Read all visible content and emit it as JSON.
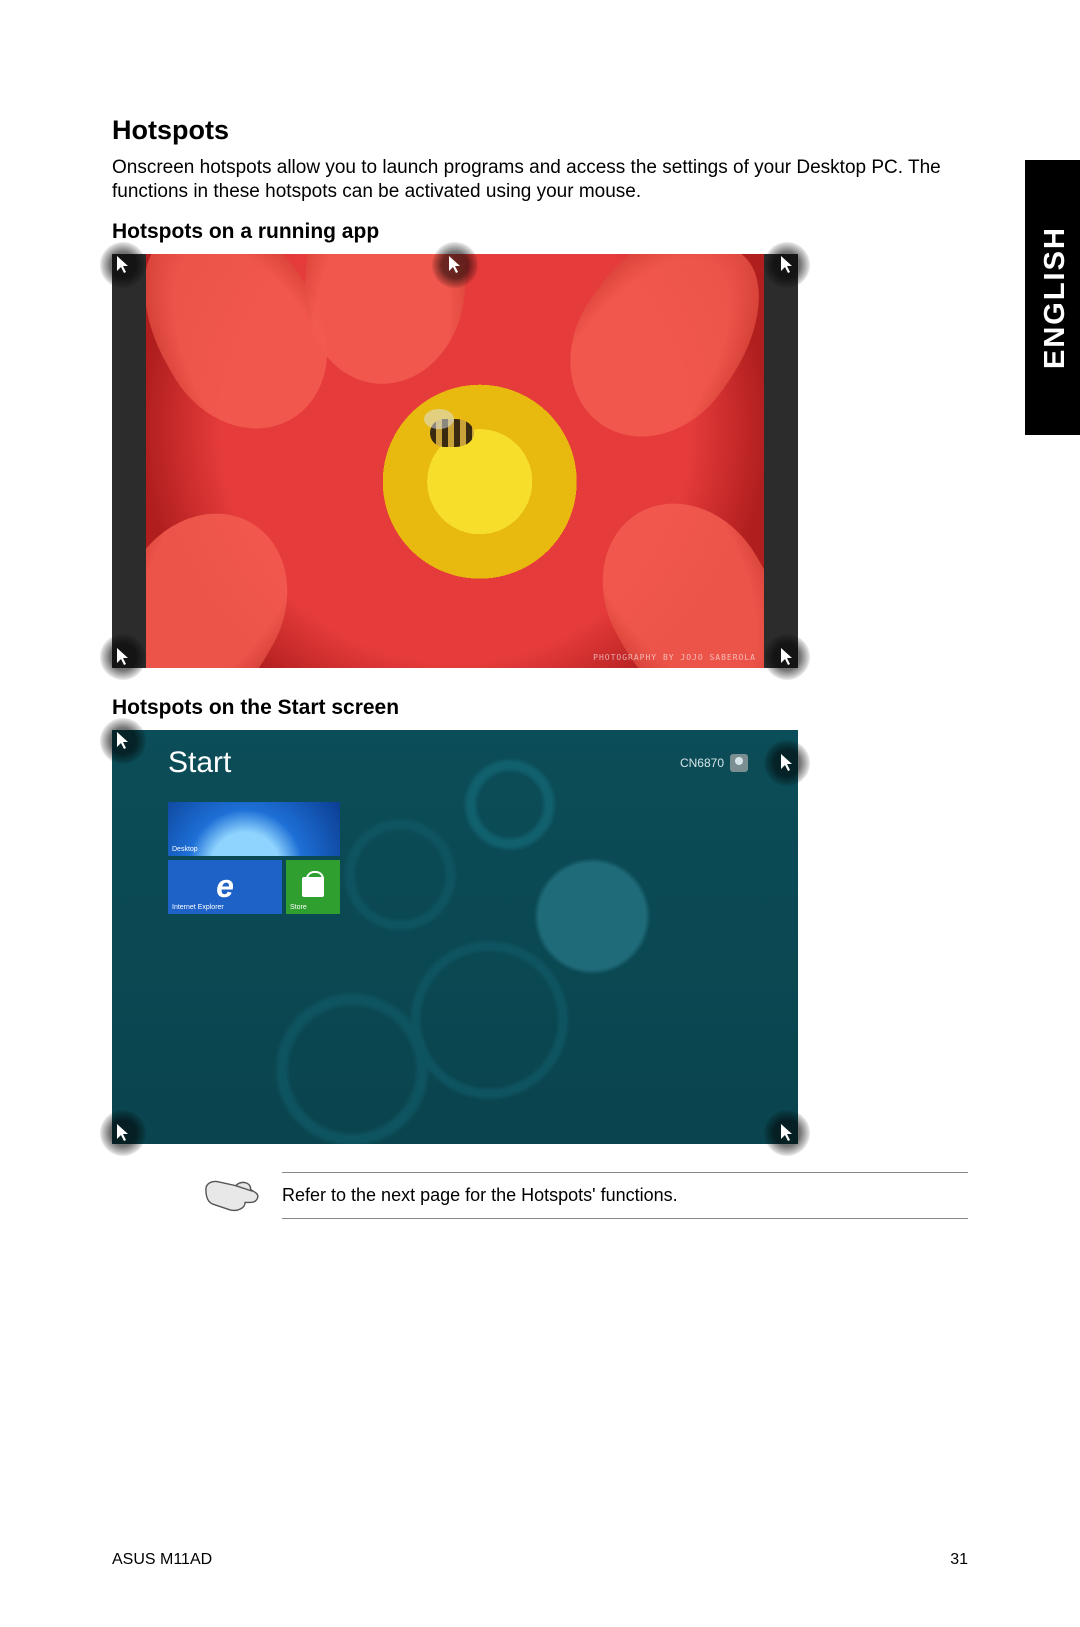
{
  "language_tab": "ENGLISH",
  "heading": "Hotspots",
  "intro": "Onscreen hotspots allow you to launch programs and access the settings of your Desktop PC. The functions in these hotspots can be activated using your mouse.",
  "sub1": "Hotspots on a running app",
  "sub2": "Hotspots on the Start screen",
  "flower_watermark": "PHOTOGRAPHY BY JOJO SABEROLA",
  "start": {
    "title": "Start",
    "user": "CN6870",
    "tiles": {
      "desktop": "Desktop",
      "ie": "Internet Explorer",
      "store": "Store"
    }
  },
  "note": "Refer to the next page for the Hotspots' functions.",
  "footer": {
    "model": "ASUS M11AD",
    "page": "31"
  }
}
